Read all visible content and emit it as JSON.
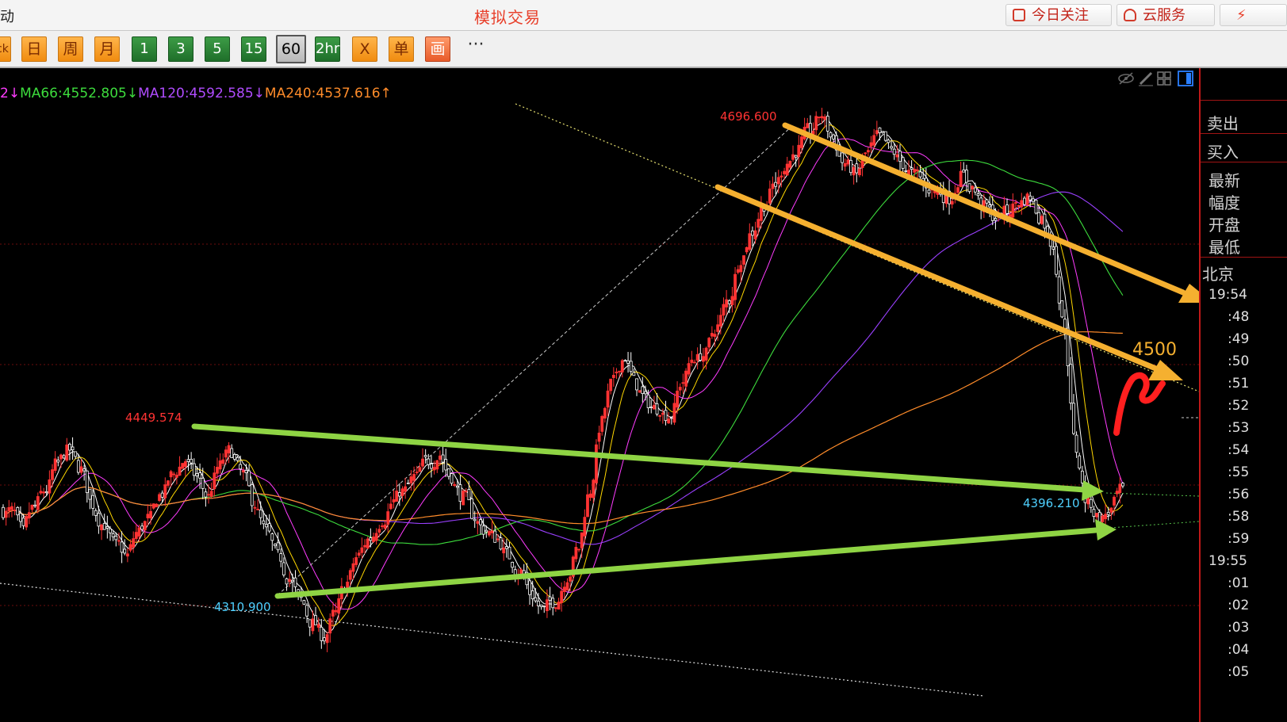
{
  "top_bar": {
    "left_truncated": "动",
    "title": "模拟交易",
    "buttons": [
      {
        "label": "今日关注",
        "icon": "calendar-icon"
      },
      {
        "label": "云服务",
        "icon": "cloud-icon"
      }
    ]
  },
  "toolbar": {
    "left_truncated": "ck",
    "buttons": [
      {
        "label": "日",
        "style": "orange"
      },
      {
        "label": "周",
        "style": "orange"
      },
      {
        "label": "月",
        "style": "orange"
      },
      {
        "label": "1",
        "style": "green"
      },
      {
        "label": "3",
        "style": "green"
      },
      {
        "label": "5",
        "style": "green"
      },
      {
        "label": "15",
        "style": "green"
      },
      {
        "label": "60",
        "style": "active"
      },
      {
        "label": "2hr",
        "style": "green"
      },
      {
        "label": "X",
        "style": "orange"
      },
      {
        "label": "单",
        "style": "orange"
      },
      {
        "label": "画",
        "style": "pink"
      }
    ],
    "more": "···"
  },
  "ma_legend": [
    {
      "text": "2↓",
      "color": "#ff3cff"
    },
    {
      "text": "MA66:4552.805↓",
      "color": "#3ddc3d"
    },
    {
      "text": "MA120:4592.585↓",
      "color": "#b04cff"
    },
    {
      "text": "MA240:4537.616↑",
      "color": "#ff8c2a"
    }
  ],
  "annotations": {
    "high_price": "4696.600",
    "mid_high": "4449.574",
    "low_price": "4310.900",
    "recent_low": "4396.210",
    "target": "4500"
  },
  "right_panel": {
    "labels": [
      "卖出",
      "买入",
      "最新",
      "幅度",
      "开盘",
      "最低"
    ],
    "location": "北京",
    "times": [
      "19:54",
      ":48",
      ":49",
      ":50",
      ":51",
      ":52",
      ":53",
      ":54",
      ":55",
      ":56",
      ":58",
      ":59",
      "19:55",
      ":01",
      ":02",
      ":03",
      ":04",
      ":05"
    ]
  },
  "colors": {
    "up": "#ff3333",
    "down": "#ffffff",
    "channel_arrow": "#f5b030",
    "support_arrow": "#8fd444",
    "scribble": "#ff1f1f"
  },
  "chart_data": {
    "type": "candlestick",
    "x_unit": "60-minute bars",
    "ylim": [
      4250,
      4730
    ],
    "moving_averages": [
      {
        "name": "MA66",
        "value": 4552.805
      },
      {
        "name": "MA120",
        "value": 4592.585
      },
      {
        "name": "MA240",
        "value": 4537.616
      }
    ],
    "key_levels": [
      4696.6,
      4449.574,
      4310.9,
      4396.21,
      4500
    ],
    "path": [
      4405,
      4390,
      4408,
      4420,
      4440,
      4450,
      4435,
      4410,
      4395,
      4380,
      4372,
      4390,
      4400,
      4418,
      4432,
      4442,
      4430,
      4415,
      4438,
      4449,
      4432,
      4410,
      4390,
      4372,
      4355,
      4340,
      4322,
      4312,
      4330,
      4352,
      4372,
      4385,
      4398,
      4412,
      4420,
      4430,
      4442,
      4446,
      4430,
      4415,
      4400,
      4390,
      4384,
      4372,
      4360,
      4343,
      4332,
      4338,
      4356,
      4378,
      4420,
      4470,
      4500,
      4518,
      4498,
      4485,
      4480,
      4475,
      4500,
      4518,
      4520,
      4540,
      4560,
      4590,
      4610,
      4630,
      4645,
      4660,
      4670,
      4684,
      4696,
      4678,
      4660,
      4652,
      4668,
      4680,
      4670,
      4660,
      4652,
      4645,
      4640,
      4635,
      4650,
      4642,
      4628,
      4620,
      4625,
      4632,
      4636,
      4620,
      4600,
      4540,
      4450,
      4410,
      4400,
      4405,
      4420
    ]
  }
}
